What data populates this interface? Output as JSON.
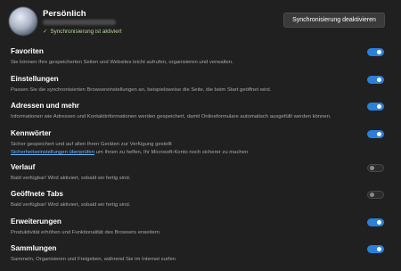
{
  "profile": {
    "name": "Persönlich",
    "sync_status": "Synchronisierung ist aktiviert",
    "sync_button": "Synchronisierung deaktivieren"
  },
  "settings": [
    {
      "title": "Favoriten",
      "desc": "Sie können Ihre gespeicherten Seiten und Websites leicht aufrufen, organisieren und verwalten.",
      "enabled": true
    },
    {
      "title": "Einstellungen",
      "desc": "Passen Sie die synchronisierten Browsereinstellungen an, beispielsweise die Seite, die beim Start geöffnet wird.",
      "enabled": true
    },
    {
      "title": "Adressen und mehr",
      "desc": "Informationen wie Adressen und Kontaktinformationen werden gespeichert, damit Onlineformulare automatisch ausgefüllt werden können.",
      "enabled": true
    },
    {
      "title": "Kennwörter",
      "desc": "Sicher gespeichert und auf allen Ihren Geräten zur Verfügung gestellt",
      "link_text": "Sicherheitseinstellungen überprüfen",
      "link_suffix": " um Ihnen zu helfen, Ihr Microsoft-Konto noch sicherer zu machen",
      "enabled": true
    },
    {
      "title": "Verlauf",
      "desc": "Bald verfügbar! Wird aktiviert, sobald wir fertig sind.",
      "enabled": false
    },
    {
      "title": "Geöffnete Tabs",
      "desc": "Bald verfügbar! Wird aktiviert, sobald wir fertig sind.",
      "enabled": false
    },
    {
      "title": "Erweiterungen",
      "desc": "Produktivität erhöhen und Funktionalität des Browsers erweitern",
      "enabled": true
    },
    {
      "title": "Sammlungen",
      "desc": "Sammeln, Organisieren und Freigeben, während Sie im Internet surfen",
      "enabled": true
    }
  ],
  "colors": {
    "background": "#202020",
    "accent": "#2b7fd6",
    "link": "#6cb6ff",
    "sync_ok": "#9ad06e"
  },
  "icons": {
    "sync_status": "check-icon"
  }
}
